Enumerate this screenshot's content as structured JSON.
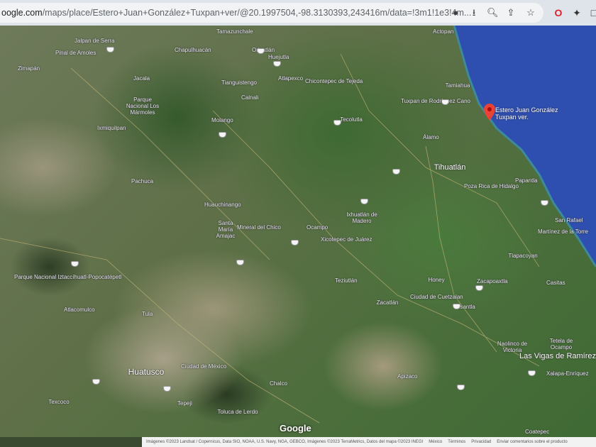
{
  "browser": {
    "url_host": "oogle.com",
    "url_path": "/maps/place/Estero+Juan+González+Tuxpan+ver/@20.1997504,-98.3130393,243416m/data=!3m1!1e3!4m...",
    "icons": [
      "location-icon",
      "install-icon",
      "zoom-icon",
      "share-icon",
      "bookmark-star-icon",
      "opera-icon",
      "extensions-icon",
      "sidepanel-icon"
    ]
  },
  "map": {
    "marker_label_line1": "Estero Juan González",
    "marker_label_line2": "Tuxpan ver.",
    "marker_color": "#ea4335",
    "ocean_color": "#2f4fb0",
    "places": [
      "Tamazunchale",
      "Jalpan de Serra",
      "Pinal de Amoles",
      "Chapulhuacán",
      "Orizatlán",
      "Huejutla",
      "Atlapexco",
      "Chicontepec de Tejeda",
      "Tianguistengo",
      "Calnali",
      "Molango",
      "Jacala",
      "Parque Nacional Los Mármoles",
      "Zimapán",
      "Ixmiquilpan",
      "Actopan",
      "Tamiahua",
      "Tuxpan de Rodríguez Cano",
      "Álamo",
      "Tihuatlán",
      "Poza Rica de Hidalgo",
      "Papantla",
      "Tecolutla",
      "Ixhuatlán de Madero",
      "Xicotepec de Juárez",
      "Huauchinango",
      "Santa María Amajac",
      "Mineral del Chico",
      "Ocampo",
      "Pachuca",
      "Honey",
      "Ciudad de Cuetzalan",
      "Zacapoaxtla",
      "Tlapacoyan",
      "Martínez de la Torre",
      "San Rafael",
      "Casitas",
      "Misantla",
      "Teziutlán",
      "Zacatlán",
      "Tetela de Ocampo",
      "Naolinco de Victoria",
      "Las Vigas de Ramírez",
      "Xalapa-Enríquez",
      "Coatepec",
      "Huatusco",
      "Ciudad de México",
      "Texcoco",
      "Toluca de Lerdo",
      "Parque Nacional Iztaccíhuatl-Popocatépetl",
      "Atlacomulco",
      "Tula",
      "Tepeji",
      "Chalco",
      "Apizaco"
    ],
    "google_logo": "Google"
  },
  "footer": {
    "attribution": "Imágenes ©2023 Landsat / Copernicus, Data SIO, NOAA, U.S. Navy, NGA, GEBCO, Imágenes ©2023 TerraMetrics, Datos del mapa ©2023 INEGI",
    "country": "México",
    "terms": "Términos",
    "privacy": "Privacidad",
    "feedback": "Enviar comentarios sobre el producto"
  }
}
